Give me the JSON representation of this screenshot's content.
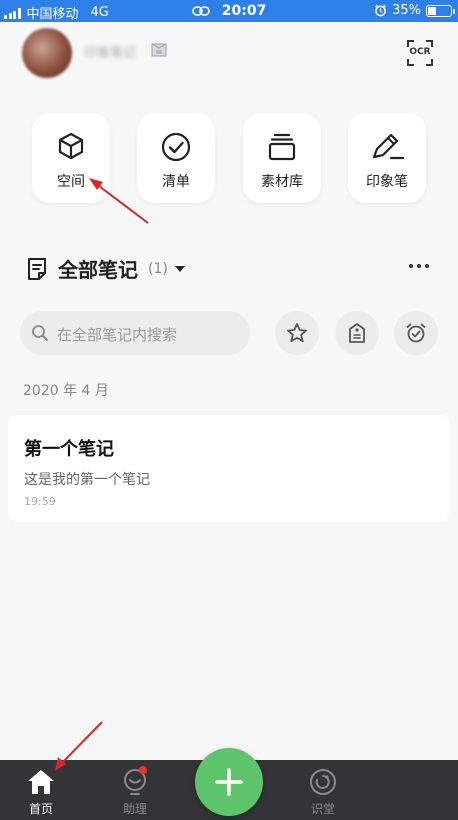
{
  "status_bar": {
    "carrier": "中国移动",
    "network": "4G",
    "time": "20:07",
    "battery": "35%",
    "battery_level": 0.35
  },
  "profile": {
    "username": "印象笔记"
  },
  "header": {
    "ocr_label": "OCR"
  },
  "tiles": [
    {
      "label": "空间",
      "icon": "cube-icon"
    },
    {
      "label": "清单",
      "icon": "check-circle-icon"
    },
    {
      "label": "素材库",
      "icon": "stack-icon"
    },
    {
      "label": "印象笔",
      "icon": "pen-icon"
    }
  ],
  "section": {
    "title": "全部笔记",
    "count": "(1)"
  },
  "search": {
    "placeholder": "在全部笔记内搜索"
  },
  "notes_group": {
    "date": "2020 年 4 月"
  },
  "notes": [
    {
      "title": "第一个笔记",
      "preview": "这是我的第一个笔记",
      "time": "19:59"
    }
  ],
  "bottom_nav": {
    "home": "首页",
    "assistant": "助理",
    "learn": "识堂"
  },
  "colors": {
    "status_bar": "#2f7fe8",
    "accent_green": "#5dc46b",
    "nav_bg": "#333438",
    "annotation_red": "#d8262a"
  }
}
